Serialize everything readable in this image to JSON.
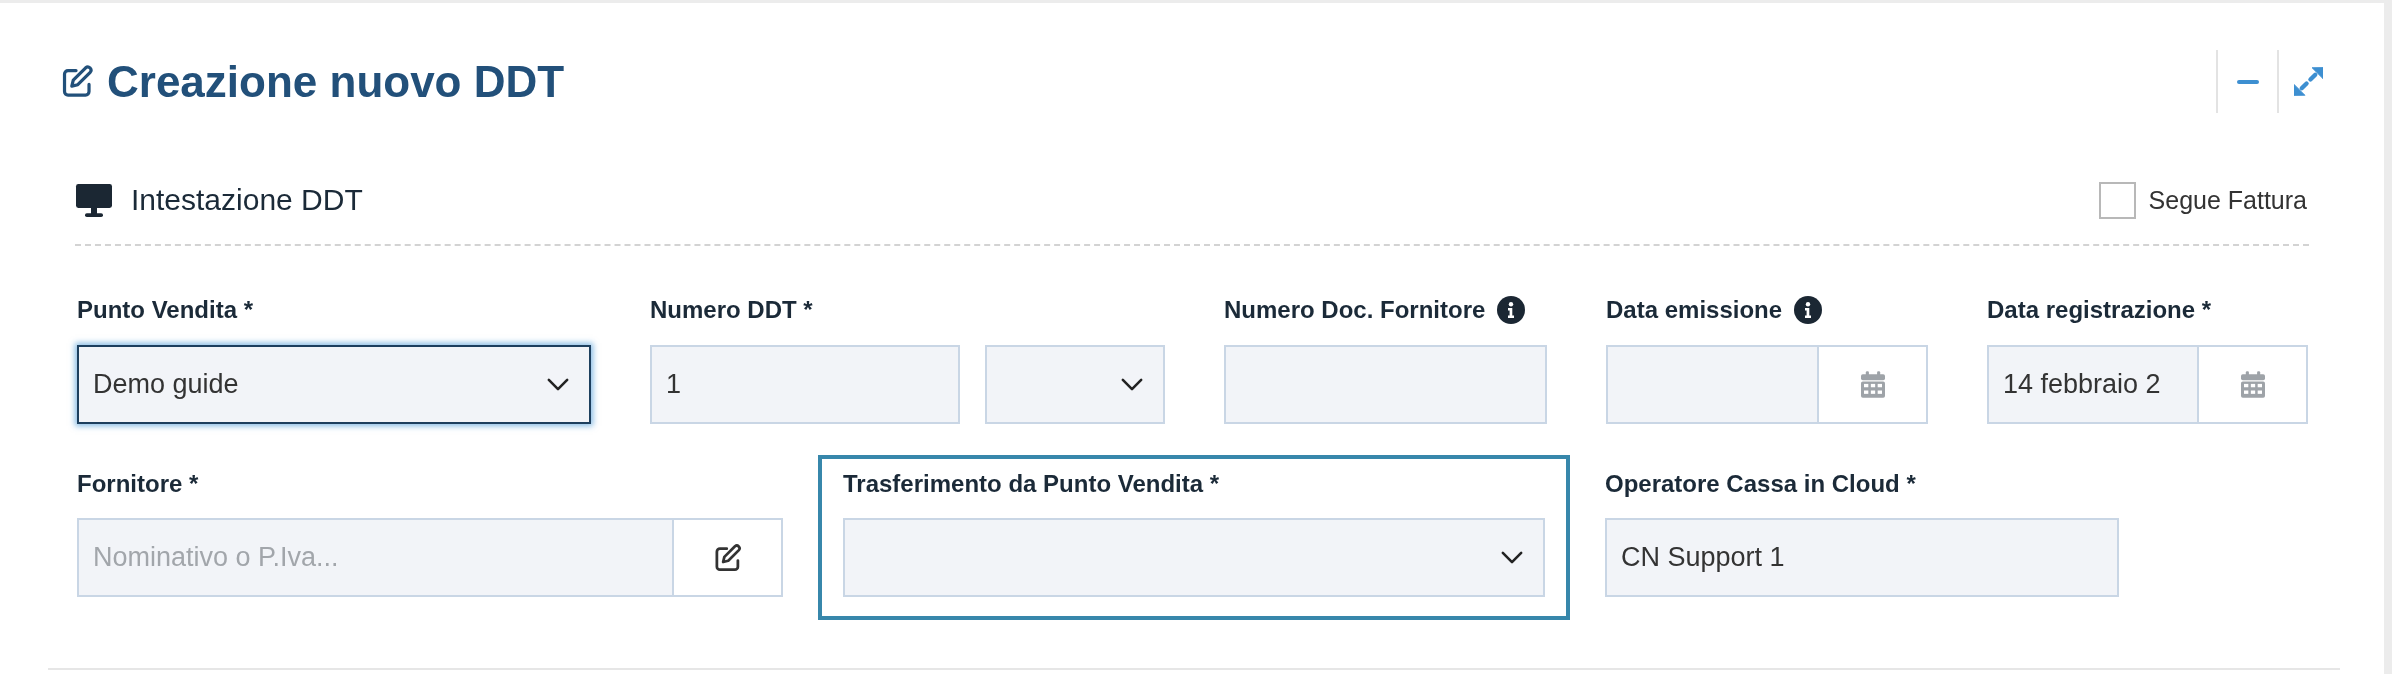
{
  "panel": {
    "title": "Creazione nuovo DDT",
    "actions": [
      {
        "kind": "minimize"
      },
      {
        "kind": "expand"
      }
    ]
  },
  "section": {
    "title": "Intestazione DDT",
    "checkbox": {
      "label": "Segue Fattura",
      "checked": false
    }
  },
  "rows": [
    [
      {
        "label": "Punto Vendita *",
        "info": false,
        "highlighted": false,
        "controls": [
          {
            "kind": "select",
            "value": "Demo guide",
            "focused": true
          }
        ]
      },
      {
        "label": "Numero DDT *",
        "info": false,
        "highlighted": false,
        "controls": [
          {
            "kind": "input",
            "value": "1",
            "focused": false
          },
          {
            "kind": "select",
            "focused": false
          }
        ]
      },
      {
        "label": "Numero Doc. Fornitore",
        "info": true,
        "highlighted": false,
        "controls": [
          {
            "kind": "input",
            "focused": false
          }
        ]
      },
      {
        "label": "Data emissione",
        "info": true,
        "highlighted": false,
        "controls": [
          {
            "kind": "date",
            "focused": false
          }
        ]
      },
      {
        "label": "Data registrazione *",
        "info": false,
        "highlighted": false,
        "controls": [
          {
            "kind": "date",
            "value": "14 febbraio 2",
            "focused": false
          }
        ]
      }
    ],
    [
      {
        "label": "Fornitore *",
        "info": false,
        "highlighted": false,
        "controls": [
          {
            "kind": "lookup",
            "placeholder": "Nominativo o P.Iva...",
            "focused": false
          }
        ]
      },
      {
        "label": "Trasferimento da Punto Vendita *",
        "info": false,
        "highlighted": true,
        "controls": [
          {
            "kind": "select",
            "focused": false
          }
        ]
      },
      {
        "label": "Operatore Cassa in Cloud *",
        "info": false,
        "highlighted": false,
        "controls": [
          {
            "kind": "input",
            "value": "CN Support 1",
            "focused": false
          }
        ]
      }
    ]
  ]
}
